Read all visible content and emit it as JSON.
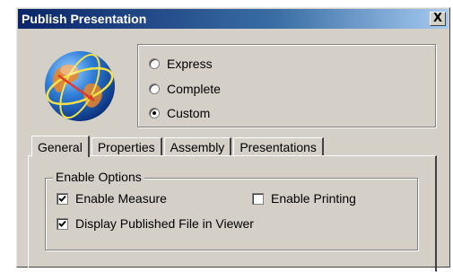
{
  "window": {
    "title": "Publish Presentation",
    "close_glyph": "X"
  },
  "icons": {
    "app": "globe-icon",
    "close": "close-icon"
  },
  "publish_mode": {
    "options": [
      {
        "label": "Express",
        "checked": false
      },
      {
        "label": "Complete",
        "checked": false
      },
      {
        "label": "Custom",
        "checked": true
      }
    ]
  },
  "tabs": [
    {
      "label": "General",
      "active": true
    },
    {
      "label": "Properties",
      "active": false
    },
    {
      "label": "Assembly",
      "active": false
    },
    {
      "label": "Presentations",
      "active": false
    }
  ],
  "general": {
    "group_title": "Enable Options",
    "enable_measure": {
      "label": "Enable Measure",
      "checked": true
    },
    "enable_printing": {
      "label": "Enable Printing",
      "checked": false
    },
    "display_in_viewer": {
      "label": "Display Published File in Viewer",
      "checked": true
    }
  }
}
